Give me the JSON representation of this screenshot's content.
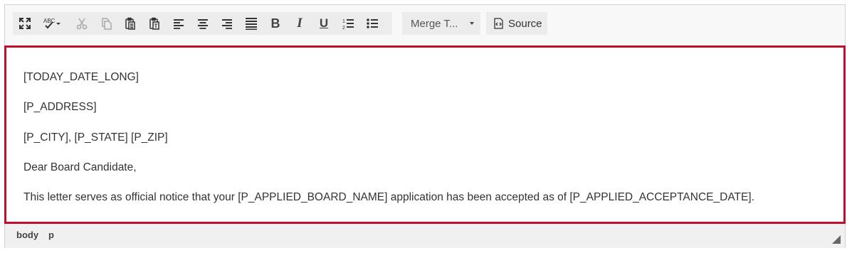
{
  "toolbar": {
    "buttons": [
      {
        "name": "maximize-button",
        "icon": "maximize-icon",
        "disabled": false
      },
      {
        "name": "spellcheck-button",
        "icon": "spellcheck-icon",
        "disabled": false
      },
      {
        "name": "cut-button",
        "icon": "cut-icon",
        "disabled": true
      },
      {
        "name": "copy-button",
        "icon": "copy-icon",
        "disabled": true
      },
      {
        "name": "paste-button",
        "icon": "paste-icon",
        "disabled": false
      },
      {
        "name": "paste-text-button",
        "icon": "paste-text-icon",
        "disabled": false
      },
      {
        "name": "align-left-button",
        "icon": "align-left-icon",
        "disabled": false
      },
      {
        "name": "align-center-button",
        "icon": "align-center-icon",
        "disabled": false
      },
      {
        "name": "align-right-button",
        "icon": "align-right-icon",
        "disabled": false
      },
      {
        "name": "justify-button",
        "icon": "justify-icon",
        "disabled": false
      },
      {
        "name": "bold-button",
        "icon": "bold-icon",
        "text": "B",
        "disabled": false
      },
      {
        "name": "italic-button",
        "icon": "italic-icon",
        "text": "I",
        "disabled": false
      },
      {
        "name": "underline-button",
        "icon": "underline-icon",
        "text": "U",
        "disabled": false
      },
      {
        "name": "numbered-list-button",
        "icon": "numbered-list-icon",
        "disabled": false
      },
      {
        "name": "bulleted-list-button",
        "icon": "bulleted-list-icon",
        "disabled": false
      }
    ],
    "merge_label": "Merge T...",
    "source_label": "Source"
  },
  "content": {
    "lines": [
      "[TODAY_DATE_LONG]",
      "[P_ADDRESS]",
      "[P_CITY], [P_STATE] [P_ZIP]",
      "Dear Board Candidate,",
      "This letter serves as official notice that your [P_APPLIED_BOARD_NAME] application has been accepted as of [P_APPLIED_ACCEPTANCE_DATE]."
    ]
  },
  "statusbar": {
    "path": [
      "body",
      "p"
    ]
  },
  "colors": {
    "focus_border": "#c0102b",
    "toolbar_bg": "#ececec",
    "text": "#333333"
  }
}
